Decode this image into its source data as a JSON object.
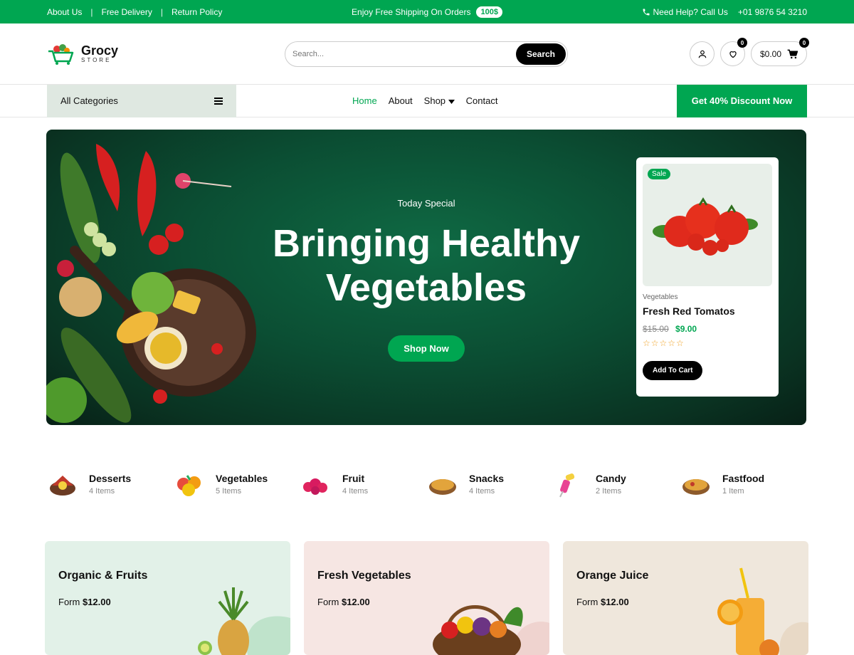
{
  "topbar": {
    "links": [
      "About Us",
      "Free Delivery",
      "Return Policy"
    ],
    "separators": [
      "|",
      "|"
    ],
    "promo_text": "Enjoy Free Shipping On Orders",
    "promo_badge": "100$",
    "help_text": "Need Help? Call Us",
    "phone": "+01 9876 54 3210"
  },
  "header": {
    "logo_name": "Grocy",
    "logo_sub": "STORE",
    "search_placeholder": "Search...",
    "search_button": "Search",
    "wishlist_count": "0",
    "cart_count": "0",
    "cart_total": "$0.00"
  },
  "nav": {
    "all_categories": "All Categories",
    "menu": [
      "Home",
      "About",
      "Shop",
      "Contact"
    ],
    "discount_cta": "Get 40% Discount Now"
  },
  "hero": {
    "subtitle": "Today Special",
    "title_line1": "Bringing Healthy",
    "title_line2": "Vegetables",
    "cta": "Shop Now"
  },
  "featured_product": {
    "badge": "Sale",
    "category": "Vegetables",
    "name": "Fresh Red Tomatos",
    "old_price": "$15.00",
    "price": "$9.00",
    "stars": "☆☆☆☆☆",
    "rating": 0,
    "button": "Add To Cart"
  },
  "categories": [
    {
      "name": "Desserts",
      "count": "4 Items"
    },
    {
      "name": "Vegetables",
      "count": "5 Items"
    },
    {
      "name": "Fruit",
      "count": "4 Items"
    },
    {
      "name": "Snacks",
      "count": "4 Items"
    },
    {
      "name": "Candy",
      "count": "2 Items"
    },
    {
      "name": "Fastfood",
      "count": "1 Item"
    }
  ],
  "promos": [
    {
      "title": "Organic & Fruits",
      "from": "Form",
      "price": "$12.00",
      "bg": "#e2f1e8"
    },
    {
      "title": "Fresh Vegetables",
      "from": "Form",
      "price": "$12.00",
      "bg": "#f6e6e3"
    },
    {
      "title": "Orange Juice",
      "from": "Form",
      "price": "$12.00",
      "bg": "#efe7dc"
    }
  ],
  "colors": {
    "accent": "#00a651",
    "dark": "#000000"
  }
}
